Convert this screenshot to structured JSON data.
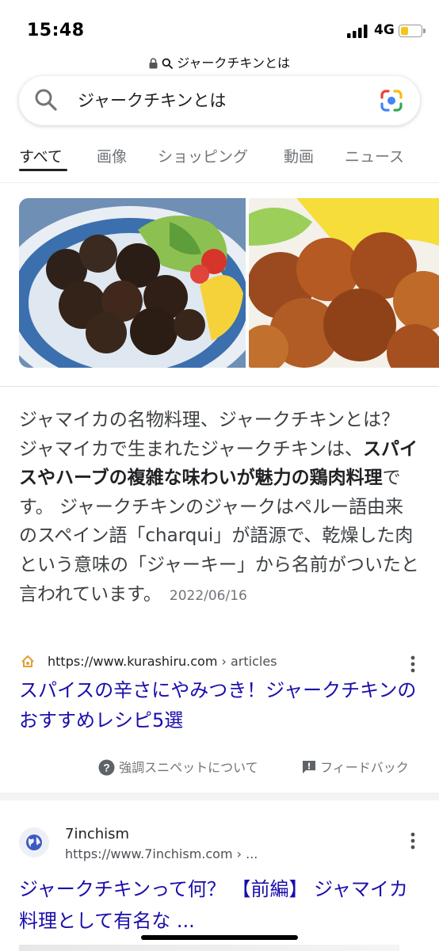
{
  "status_bar": {
    "time": "15:48",
    "network": "4G",
    "battery_level": 0.4
  },
  "url_bar": {
    "text": "ジャークチキンとは"
  },
  "search": {
    "query": "ジャークチキンとは"
  },
  "tabs": [
    {
      "label": "すべて",
      "active": true
    },
    {
      "label": "画像"
    },
    {
      "label": "ショッピング"
    },
    {
      "label": "動画"
    },
    {
      "label": "ニュース"
    }
  ],
  "snippet": {
    "part1": "ジャマイカの名物料理、ジャークチキンとは？ ジャマイカで生まれたジャークチキンは、",
    "bold": "スパイスやハーブの複雑な味わいが魅力の鶏肉料理",
    "part2": "です。 ジャークチキンのジャークはペルー語由来のスペイン語「charqui」が語源で、乾燥した肉という意味の「ジャーキー」から名前がついたと言われています。",
    "date": "2022/06/16"
  },
  "featured_source": {
    "url": "https://www.kurashiru.com",
    "crumb": " › articles",
    "title": "スパイスの辛さにやみつき！ジャークチキンのおすすめレシピ5選"
  },
  "meta": {
    "about_label": "強調スニペットについて",
    "feedback_label": "フィードバック"
  },
  "result2": {
    "site_name": "7inchism",
    "url": "https://www.7inchism.com › ...",
    "title": "ジャークチキンって何？ 【前編】 ジャマイカ料理として有名な ..."
  },
  "colors": {
    "link": "#1a0dab",
    "text": "#202124",
    "muted": "#70757a"
  }
}
